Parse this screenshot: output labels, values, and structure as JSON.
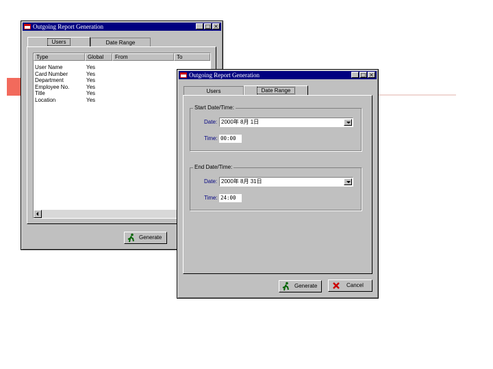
{
  "back_window": {
    "title": "Outgoing Report Generation",
    "tabs": [
      {
        "label": "Users"
      },
      {
        "label": "Date Range"
      }
    ],
    "columns": [
      "Type",
      "Global",
      "From",
      "To"
    ],
    "rows": [
      {
        "type": "User Name",
        "global": "Yes"
      },
      {
        "type": "Card Number",
        "global": "Yes"
      },
      {
        "type": "Department",
        "global": "Yes"
      },
      {
        "type": "Employee No.",
        "global": "Yes"
      },
      {
        "type": "Title",
        "global": "Yes"
      },
      {
        "type": "Location",
        "global": "Yes"
      }
    ],
    "generate_label": "Generate"
  },
  "front_window": {
    "title": "Outgoing Report Generation",
    "tabs": [
      {
        "label": "Users"
      },
      {
        "label": "Date Range"
      }
    ],
    "start": {
      "group_title": "Start Date/Time:",
      "date_label": "Date:",
      "date_value": "2000年  8月  1日",
      "time_label": "Time:",
      "time_value": "00:00"
    },
    "end": {
      "group_title": "End Date/Time:",
      "date_label": "Date:",
      "date_value": "2000年  8月 31日",
      "time_label": "Time:",
      "time_value": "24:00"
    },
    "generate_label": "Generate",
    "cancel_label": "Cancel"
  },
  "colors": {
    "titlebar": "#000080",
    "window": "#c0c0c0",
    "accent": "#f26a5c"
  }
}
